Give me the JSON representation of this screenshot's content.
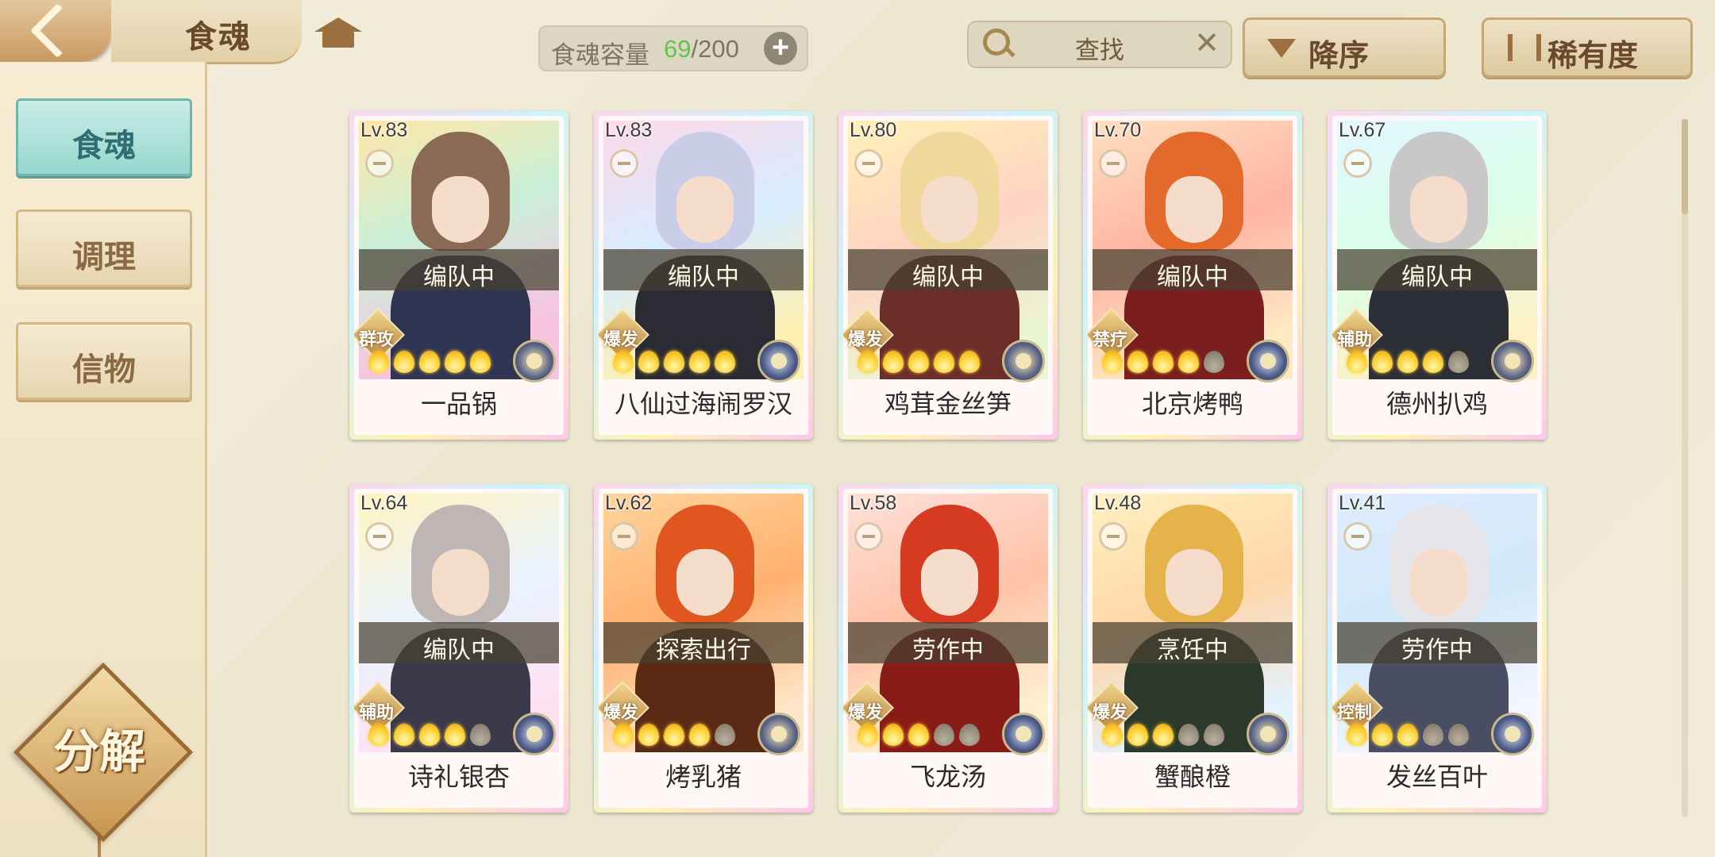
{
  "header": {
    "title": "食魂",
    "capacity_label": "食魂容量",
    "capacity_current": "69",
    "capacity_max": "/200",
    "search_placeholder": "查找",
    "sort_order_label": "降序",
    "sort_field_label": "稀有度"
  },
  "sidebar": {
    "tabs": [
      {
        "label": "食魂",
        "active": true
      },
      {
        "label": "调理",
        "active": false
      },
      {
        "label": "信物",
        "active": false
      }
    ],
    "decompose_label": "分解"
  },
  "colors": {
    "active_tab": "#96d7cf",
    "flame_on": "#ffd23a",
    "flame_off": "#7d7262",
    "capacity_current": "#62c54f"
  },
  "cards": [
    {
      "level": "Lv.83",
      "name": "一品锅",
      "status": "编队中",
      "role": "群攻",
      "stars": 5,
      "max_stars": 5
    },
    {
      "level": "Lv.83",
      "name": "八仙过海闹罗汉",
      "status": "编队中",
      "role": "爆发",
      "stars": 5,
      "max_stars": 5
    },
    {
      "level": "Lv.80",
      "name": "鸡茸金丝笋",
      "status": "编队中",
      "role": "爆发",
      "stars": 5,
      "max_stars": 5
    },
    {
      "level": "Lv.70",
      "name": "北京烤鸭",
      "status": "编队中",
      "role": "禁疗",
      "stars": 4,
      "max_stars": 5
    },
    {
      "level": "Lv.67",
      "name": "德州扒鸡",
      "status": "编队中",
      "role": "辅助",
      "stars": 4,
      "max_stars": 5
    },
    {
      "level": "Lv.64",
      "name": "诗礼银杏",
      "status": "编队中",
      "role": "辅助",
      "stars": 4,
      "max_stars": 5
    },
    {
      "level": "Lv.62",
      "name": "烤乳猪",
      "status": "探索出行",
      "role": "爆发",
      "stars": 4,
      "max_stars": 5
    },
    {
      "level": "Lv.58",
      "name": "飞龙汤",
      "status": "劳作中",
      "role": "爆发",
      "stars": 3,
      "max_stars": 5
    },
    {
      "level": "Lv.48",
      "name": "蟹酿橙",
      "status": "烹饪中",
      "role": "爆发",
      "stars": 3,
      "max_stars": 5
    },
    {
      "level": "Lv.41",
      "name": "发丝百叶",
      "status": "劳作中",
      "role": "控制",
      "stars": 3,
      "max_stars": 5
    }
  ]
}
